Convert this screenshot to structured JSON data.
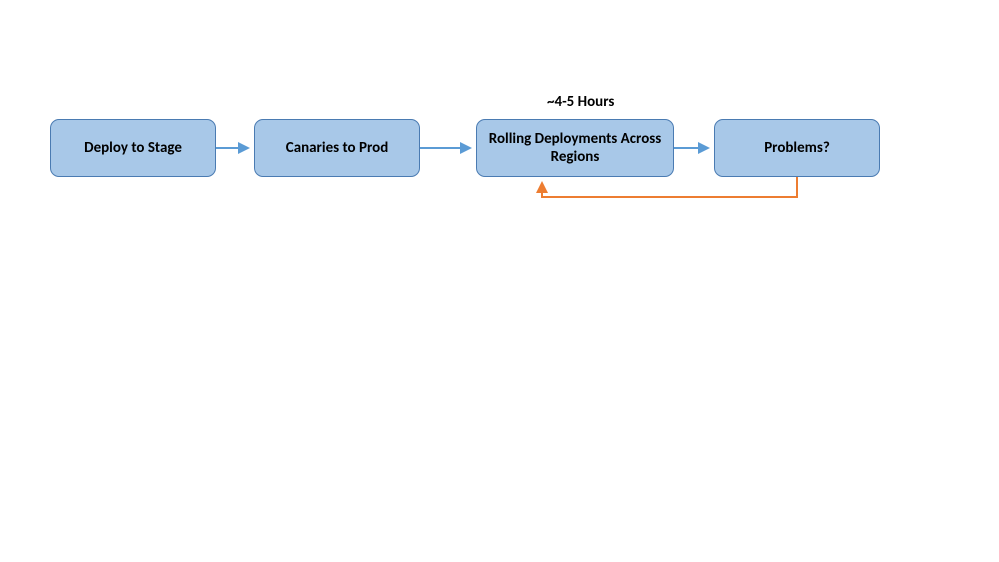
{
  "diagram": {
    "annotation": "~4-5 Hours",
    "nodes": {
      "deploy_stage": "Deploy to Stage",
      "canaries_prod": "Canaries to Prod",
      "rolling_deployments": "Rolling Deployments Across Regions",
      "problems": "Problems?"
    },
    "colors": {
      "node_fill": "#a8c8e8",
      "node_border": "#4a7bb2",
      "arrow_blue": "#5b9bd5",
      "arrow_orange": "#ed7d31"
    }
  }
}
